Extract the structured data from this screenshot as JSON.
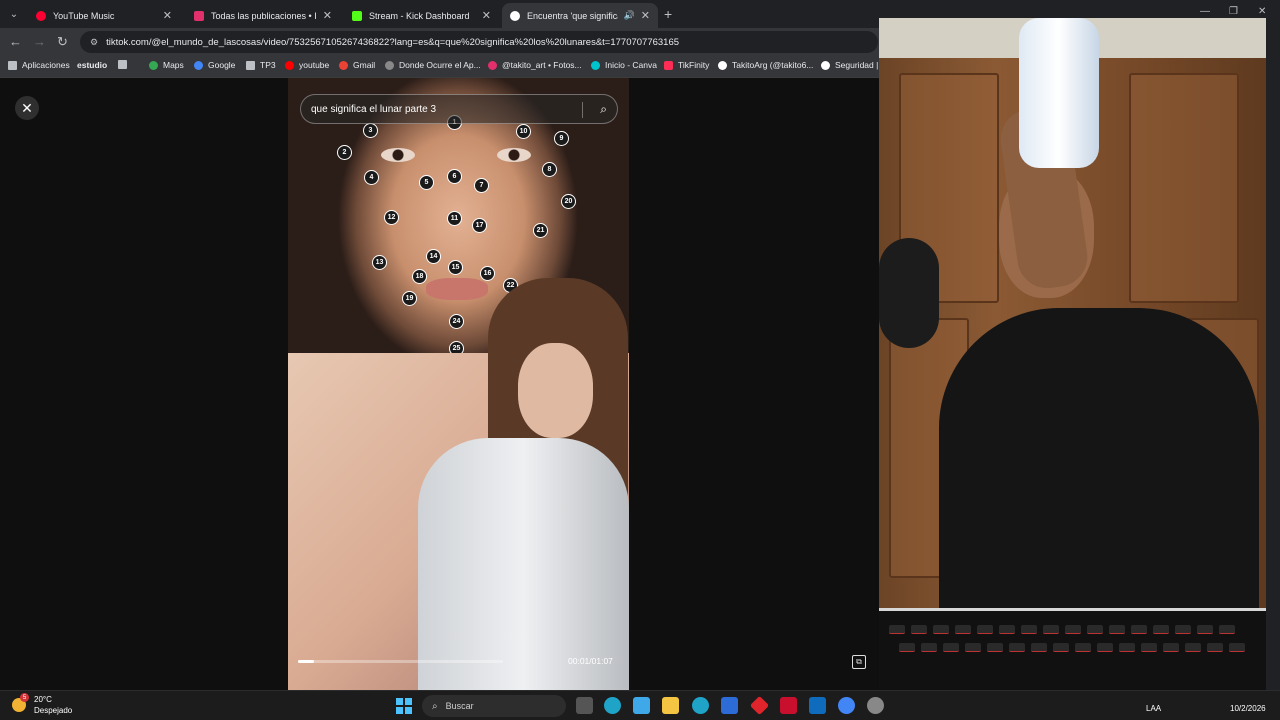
{
  "browser": {
    "tabs": [
      {
        "title": "YouTube Music",
        "color": "#ff0033",
        "active": false
      },
      {
        "title": "Todas las publicaciones • Instag",
        "color": "#e1306c",
        "active": false
      },
      {
        "title": "Stream - Kick Dashboard",
        "color": "#53fc18",
        "active": false
      },
      {
        "title": "Encuentra 'que significa los",
        "color": "#ffffff",
        "active": true
      }
    ],
    "url": "tiktok.com/@el_mundo_de_lascosas/video/7532567105267436822?lang=es&q=que%20significa%20los%20lunares&t=1770707763165",
    "bookmarks": [
      {
        "label": "Aplicaciones",
        "icon": "apps-grid-icon",
        "color": "#bdc1c6"
      },
      {
        "label": "estudio",
        "icon": "",
        "color": ""
      },
      {
        "label": "",
        "icon": "grid-icon",
        "color": "#bdc1c6"
      },
      {
        "label": "Maps",
        "icon": "maps-icon",
        "color": "#34a853"
      },
      {
        "label": "Google",
        "icon": "google-icon",
        "color": "#4285f4"
      },
      {
        "label": "TP3",
        "icon": "document-icon",
        "color": "#bdc1c6"
      },
      {
        "label": "youtube",
        "icon": "youtube-icon",
        "color": "#ff0000"
      },
      {
        "label": "Gmail",
        "icon": "gmail-icon",
        "color": "#ea4335"
      },
      {
        "label": "Donde Ocurre el Ap...",
        "icon": "globe-icon",
        "color": "#888888"
      },
      {
        "label": "@takito_art • Fotos...",
        "icon": "instagram-icon",
        "color": "#e1306c"
      },
      {
        "label": "Inicio - Canva",
        "icon": "canva-icon",
        "color": "#00c4cc"
      },
      {
        "label": "TikFinity",
        "icon": "tikfinity-icon",
        "color": "#ff2d55"
      },
      {
        "label": "TakitoArg (@takito6...",
        "icon": "tiktok-icon",
        "color": "#ffffff"
      },
      {
        "label": "Seguridad |",
        "icon": "shield-icon",
        "color": "#ffffff"
      }
    ]
  },
  "tiktok": {
    "search_query": "que significa el lunar parte 3",
    "face_numbers": [
      "1",
      "2",
      "3",
      "4",
      "5",
      "6",
      "7",
      "8",
      "9",
      "10",
      "11",
      "12",
      "13",
      "14",
      "15",
      "16",
      "17",
      "18",
      "19",
      "20",
      "21",
      "22",
      "24",
      "25"
    ],
    "time_display": "00:01/01:07",
    "progress_fraction": 0.08
  },
  "taskbar": {
    "weather_temp": "20°C",
    "weather_condition": "Despejado",
    "weather_badge": "5",
    "search_placeholder": "Buscar",
    "apps": [
      {
        "icon": "file-manager-icon",
        "color": "#555555"
      },
      {
        "icon": "edge-beta-icon",
        "color": "#1fa3c7"
      },
      {
        "icon": "copilot-icon",
        "color": "#3fa8e8"
      },
      {
        "icon": "file-explorer-icon",
        "color": "#f4c542"
      },
      {
        "icon": "edge-icon",
        "color": "#1fa3c7"
      },
      {
        "icon": "store-icon",
        "color": "#2d6bd6"
      },
      {
        "icon": "red-diamond-app-icon",
        "color": "#e0242b"
      },
      {
        "icon": "mcafee-icon",
        "color": "#c8102e"
      },
      {
        "icon": "outlook-icon",
        "color": "#0f6cbd"
      },
      {
        "icon": "chrome-icon",
        "color": "#4285f4"
      },
      {
        "icon": "settings-icon",
        "color": "#888888"
      }
    ],
    "language": "LAA",
    "date": "10/2/2026"
  }
}
